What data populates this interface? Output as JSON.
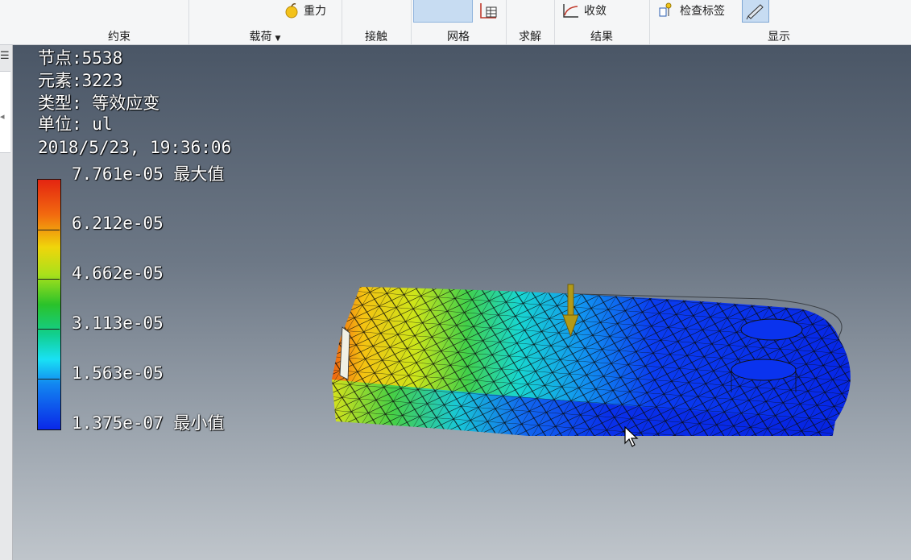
{
  "ribbon": {
    "groups": [
      {
        "label": "约束"
      },
      {
        "label": "载荷"
      },
      {
        "label": "接触"
      },
      {
        "label": "网格"
      },
      {
        "label": "求解"
      },
      {
        "label": "结果"
      },
      {
        "label": "显示"
      }
    ],
    "gravity_button": "重力",
    "convergence_button": "收敛",
    "inspect_labels_button": "检查标签",
    "loads_dropdown_icon": "chevron-down-icon"
  },
  "result": {
    "nodes_line": "节点:5538",
    "elements_line": "元素:3223",
    "type_line": "类型: 等效应变",
    "unit_line": "单位: ul",
    "timestamp_line": "2018/5/23, 19:36:06"
  },
  "legend": {
    "max_label": "7.761e-05 最大值",
    "tick_labels": [
      "6.212e-05",
      "4.662e-05",
      "3.113e-05",
      "1.563e-05"
    ],
    "min_label": "1.375e-07 最小值",
    "colors": [
      "#e42511",
      "#f0d50b",
      "#2ac22a",
      "#19e1f5",
      "#0a28e8"
    ]
  },
  "colors": {
    "ribbon_bg": "#f5f6f7",
    "active_button": "#c7dcf2",
    "load_arrow": "#b39a16"
  }
}
